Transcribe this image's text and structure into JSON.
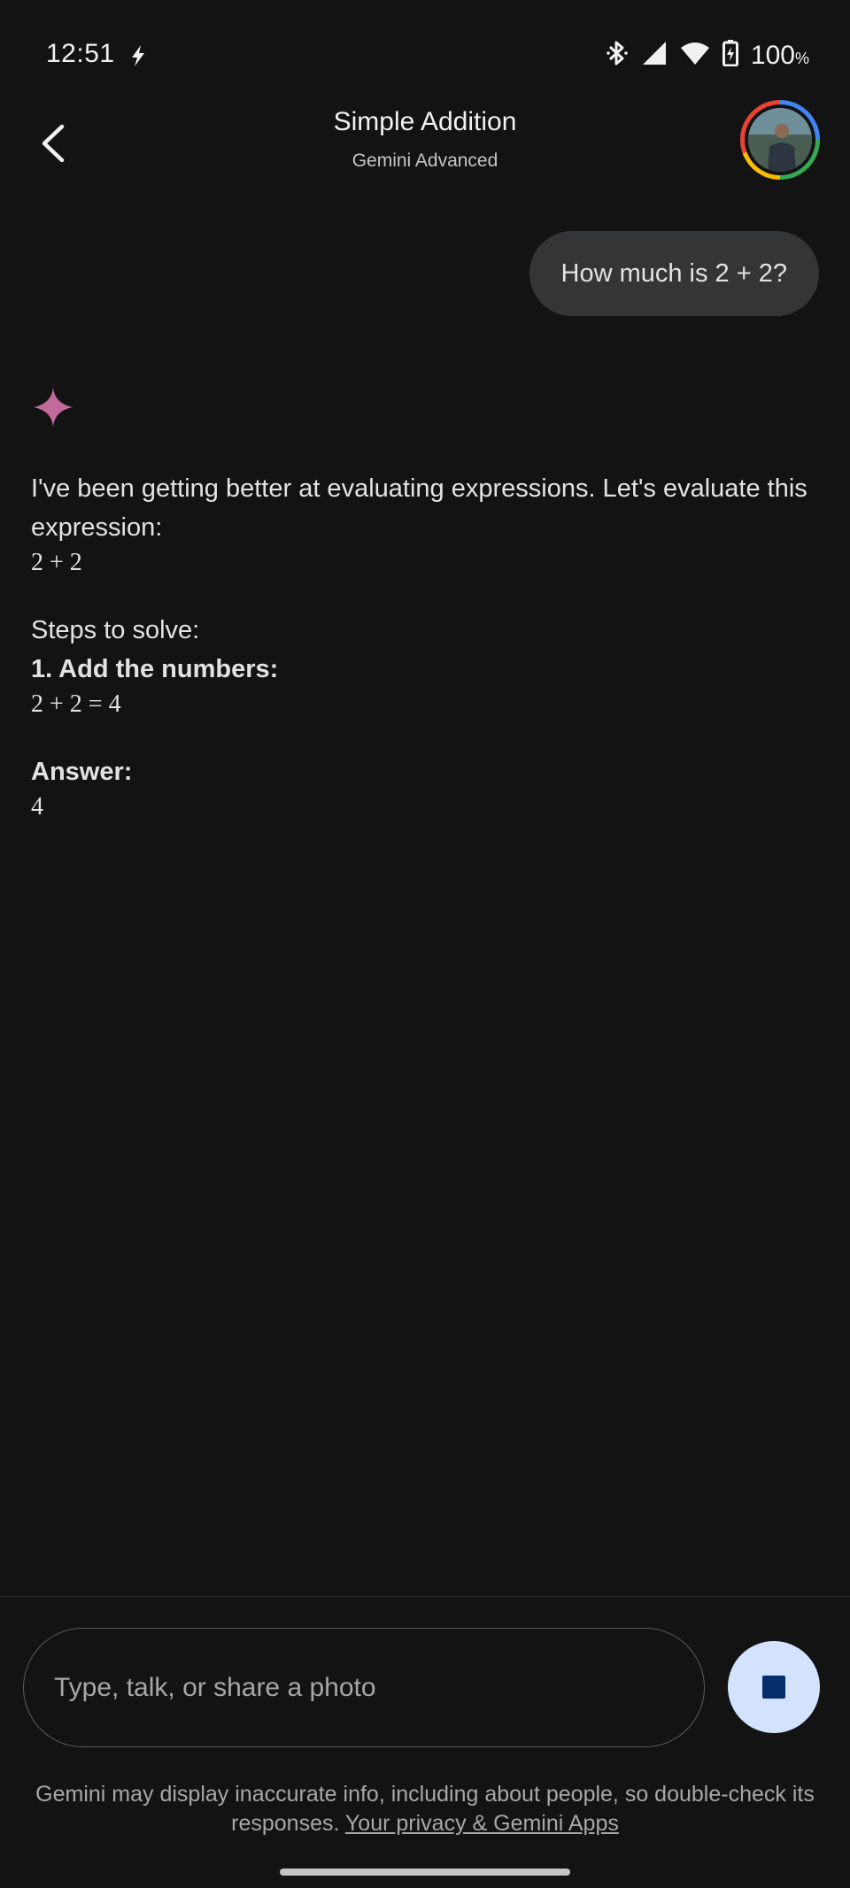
{
  "status_bar": {
    "time": "12:51",
    "battery_percent": "100",
    "battery_unit": "%",
    "icons": [
      "charging-bolt-icon",
      "bluetooth-icon",
      "signal-icon",
      "wifi-icon",
      "battery-icon"
    ]
  },
  "header": {
    "title": "Simple Addition",
    "subtitle": "Gemini Advanced",
    "back_icon": "back-arrow-icon",
    "avatar": "profile-avatar"
  },
  "conversation": {
    "user_message": "How much is 2 + 2?",
    "response": {
      "intro": "I've been getting better at evaluating expressions. Let's evaluate this expression:",
      "expression": "2 + 2",
      "steps_heading": "Steps to solve:",
      "step1_label": "1. Add the numbers:",
      "step1_math": "2 + 2 = 4",
      "answer_label": "Answer:",
      "answer_value": "4"
    }
  },
  "composer": {
    "placeholder": "Type, talk, or share a photo",
    "stop_icon": "stop-icon"
  },
  "disclaimer": {
    "text": "Gemini may display inaccurate info, including about people, so double-check its responses.",
    "link": "Your privacy & Gemini Apps"
  },
  "colors": {
    "background": "#131314",
    "bubble": "#333537",
    "stop_button": "#d3e3fd",
    "sparkle": "#c36a9c"
  }
}
